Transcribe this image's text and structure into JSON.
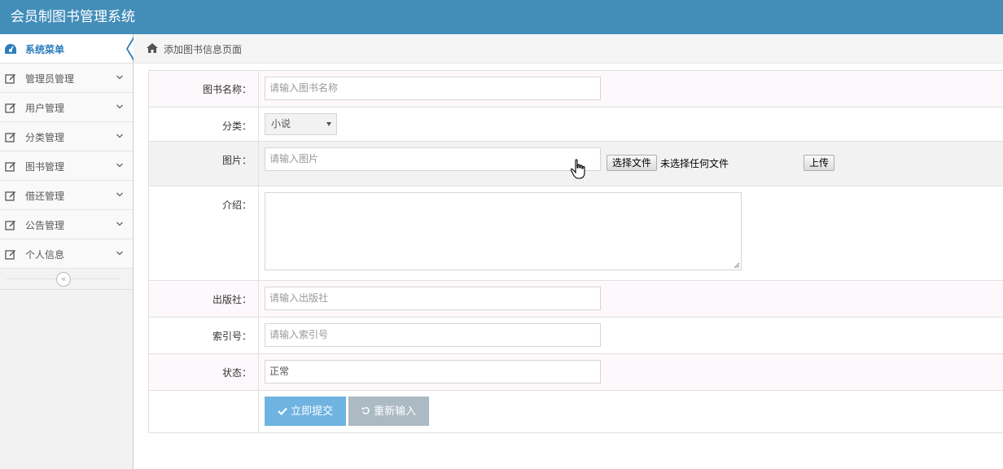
{
  "app": {
    "title": "会员制图书管理系统"
  },
  "sidebar": {
    "head": {
      "label": "系统菜单",
      "icon": "dashboard-icon"
    },
    "items": [
      {
        "label": "管理员管理",
        "icon": "edit-icon"
      },
      {
        "label": "用户管理",
        "icon": "edit-icon"
      },
      {
        "label": "分类管理",
        "icon": "edit-icon"
      },
      {
        "label": "图书管理",
        "icon": "edit-icon"
      },
      {
        "label": "借还管理",
        "icon": "edit-icon"
      },
      {
        "label": "公告管理",
        "icon": "edit-icon"
      },
      {
        "label": "个人信息",
        "icon": "edit-icon"
      }
    ],
    "collapse_glyph": "«"
  },
  "breadcrumb": {
    "text": "添加图书信息页面",
    "icon": "home-icon"
  },
  "form": {
    "name": {
      "label": "图书名称：",
      "placeholder": "请输入图书名称"
    },
    "category": {
      "label": "分类：",
      "selected": "小说"
    },
    "image": {
      "label": "图片：",
      "placeholder": "请输入图片",
      "file_button": "选择文件",
      "file_status": "未选择任何文件",
      "upload_button": "上传"
    },
    "intro": {
      "label": "介绍："
    },
    "publisher": {
      "label": "出版社：",
      "placeholder": "请输入出版社"
    },
    "index_no": {
      "label": "索引号：",
      "placeholder": "请输入索引号"
    },
    "status": {
      "label": "状态：",
      "value": "正常"
    },
    "submit": {
      "label": "立即提交",
      "icon": "check-icon"
    },
    "reset": {
      "label": "重新输入",
      "icon": "undo-icon"
    }
  },
  "colors": {
    "header": "#438eb9",
    "accent": "#2b7dbc",
    "primary_button": "#6fb3e0",
    "reset_button": "#abbac3"
  }
}
